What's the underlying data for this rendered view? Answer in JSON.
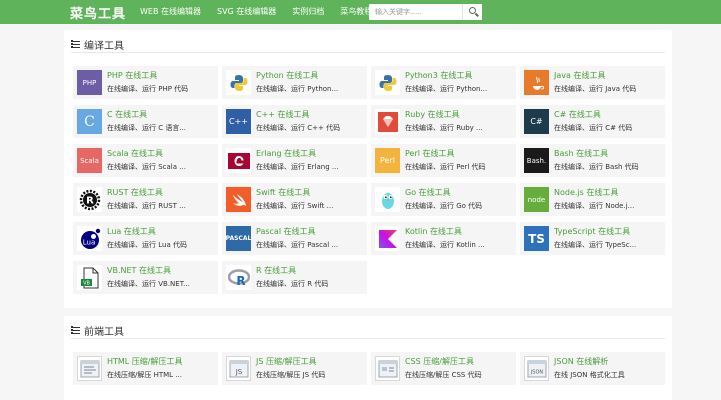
{
  "header": {
    "logo": "菜鸟工具",
    "nav": [
      "WEB 在线编辑器",
      "SVG 在线编辑器",
      "实例归档",
      "菜鸟教程"
    ],
    "search_placeholder": "输入关键字......"
  },
  "sections": [
    {
      "title": "编译工具",
      "items": [
        {
          "icon": "php-icon",
          "name": "PHP 在线工具",
          "desc": "在线编译、运行 PHP 代码"
        },
        {
          "icon": "python-icon",
          "name": "Python 在线工具",
          "desc": "在线编译、运行 Python..."
        },
        {
          "icon": "python3-icon",
          "name": "Python3 在线工具",
          "desc": "在线编译、运行 Python..."
        },
        {
          "icon": "java-icon",
          "name": "Java 在线工具",
          "desc": "在线编译、运行 Java 代码"
        },
        {
          "icon": "c-icon",
          "name": "C 在线工具",
          "desc": "在线编译、运行 C 语言..."
        },
        {
          "icon": "cpp-icon",
          "name": "C++ 在线工具",
          "desc": "在线编译、运行 C++ 代码"
        },
        {
          "icon": "ruby-icon",
          "name": "Ruby 在线工具",
          "desc": "在线编译、运行 Ruby ..."
        },
        {
          "icon": "csharp-icon",
          "name": "C# 在线工具",
          "desc": "在线编译、运行 C# 代码"
        },
        {
          "icon": "scala-icon",
          "name": "Scala 在线工具",
          "desc": "在线编译、运行 Scala ..."
        },
        {
          "icon": "erlang-icon",
          "name": "Erlang 在线工具",
          "desc": "在线编译、运行 Erlang ..."
        },
        {
          "icon": "perl-icon",
          "name": "Perl 在线工具",
          "desc": "在线编译、运行 Perl 代码"
        },
        {
          "icon": "bash-icon",
          "name": "Bash 在线工具",
          "desc": "在线编译、运行 Bash 代码"
        },
        {
          "icon": "rust-icon",
          "name": "RUST 在线工具",
          "desc": "在线编译、运行 RUST ..."
        },
        {
          "icon": "swift-icon",
          "name": "Swift 在线工具",
          "desc": "在线编译、运行 Swift ..."
        },
        {
          "icon": "go-icon",
          "name": "Go 在线工具",
          "desc": "在线编译、运行 Go 代码"
        },
        {
          "icon": "nodejs-icon",
          "name": "Node.js 在线工具",
          "desc": "在线编译、运行 Node.j..."
        },
        {
          "icon": "lua-icon",
          "name": "Lua 在线工具",
          "desc": "在线编译、运行 Lua 代码"
        },
        {
          "icon": "pascal-icon",
          "name": "Pascal 在线工具",
          "desc": "在线编译、运行 Pascal ..."
        },
        {
          "icon": "kotlin-icon",
          "name": "Kotlin 在线工具",
          "desc": "在线编译、运行 Kotlin ..."
        },
        {
          "icon": "typescript-icon",
          "name": "TypeScript 在线工具",
          "desc": "在线编译、运行 TypeSc..."
        },
        {
          "icon": "vbnet-icon",
          "name": "VB.NET 在线工具",
          "desc": "在线编译、运行 VB.NET..."
        },
        {
          "icon": "r-icon",
          "name": "R 在线工具",
          "desc": "在线编译、运行 R 代码"
        }
      ]
    },
    {
      "title": "前端工具",
      "items": [
        {
          "icon": "html-tool-icon",
          "name": "HTML 压缩/解压工具",
          "desc": "在线压缩/解压 HTML ..."
        },
        {
          "icon": "js-tool-icon",
          "name": "JS 压缩/解压工具",
          "desc": "在线压缩/解压 JS 代码"
        },
        {
          "icon": "css-tool-icon",
          "name": "CSS 压缩/解压工具",
          "desc": "在线压缩/解压 CSS 代码"
        },
        {
          "icon": "json-tool-icon",
          "name": "JSON 在线解析",
          "desc": "在线 JSON 格式化工具"
        }
      ]
    }
  ]
}
